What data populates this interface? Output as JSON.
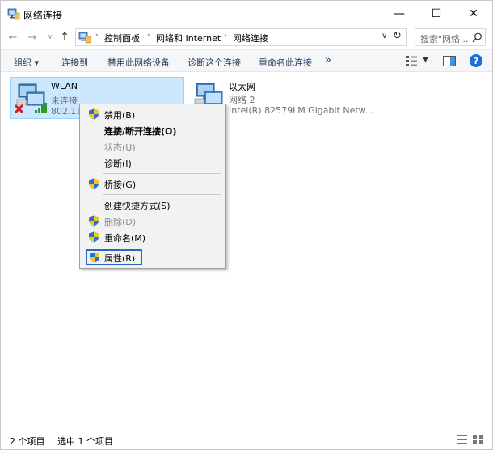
{
  "window": {
    "title": "网络连接",
    "controls": {
      "minimize": "—",
      "maximize": "☐",
      "close": "✕"
    }
  },
  "address": {
    "breadcrumbs": [
      "控制面板",
      "网络和 Internet",
      "网络连接"
    ],
    "search_placeholder": "搜索\"网络...",
    "refresh_icon": "↻",
    "dropdown_icon": "∨"
  },
  "nav": {
    "back": "←",
    "forward": "→",
    "recent": "∨",
    "up": "↑"
  },
  "commands": {
    "organize": "组织 ▾",
    "connect_to": "连接到",
    "disable_device": "禁用此网络设备",
    "diagnose": "诊断这个连接",
    "rename": "重命名此连接",
    "more": "»"
  },
  "connections": [
    {
      "name": "WLAN",
      "status": "未连接",
      "device": "802.11n",
      "selected": true,
      "icon": "wifi-adapter-icon"
    },
    {
      "name": "以太网",
      "status": "网络 2",
      "device": "Intel(R) 82579LM Gigabit Netw...",
      "selected": false,
      "icon": "ethernet-adapter-icon"
    }
  ],
  "context_menu": {
    "items": [
      {
        "label": "禁用(B)",
        "shield": true,
        "bold": false,
        "disabled": false
      },
      {
        "label": "连接/断开连接(O)",
        "shield": false,
        "bold": true,
        "disabled": false
      },
      {
        "label": "状态(U)",
        "shield": false,
        "bold": false,
        "disabled": true
      },
      {
        "label": "诊断(I)",
        "shield": false,
        "bold": false,
        "disabled": false
      },
      {
        "label": "桥接(G)",
        "shield": true,
        "bold": false,
        "disabled": false
      },
      {
        "label": "创建快捷方式(S)",
        "shield": false,
        "bold": false,
        "disabled": false
      },
      {
        "label": "删除(D)",
        "shield": true,
        "bold": false,
        "disabled": true
      },
      {
        "label": "重命名(M)",
        "shield": true,
        "bold": false,
        "disabled": false
      },
      {
        "label": "属性(R)",
        "shield": true,
        "bold": false,
        "disabled": false,
        "highlighted": true
      }
    ]
  },
  "statusbar": {
    "item_count": "2 个项目",
    "selected_count": "选中 1 个项目"
  },
  "colors": {
    "selection_bg": "#cce8ff",
    "selection_border": "#99d1ff",
    "highlight_border": "#2a67c4",
    "command_text": "#1e395b",
    "help_blue": "#1c6fd6"
  }
}
